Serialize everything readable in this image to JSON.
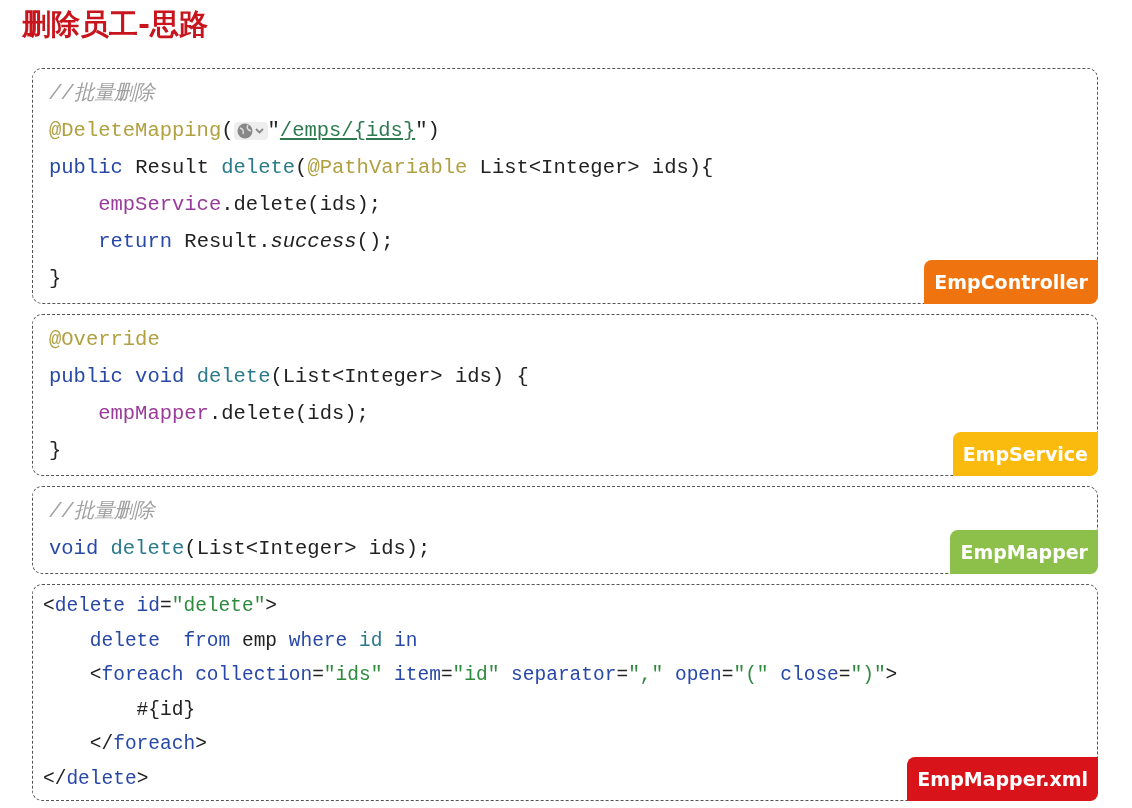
{
  "title": "删除员工-思路",
  "panels": [
    {
      "label": "EmpController",
      "color": "#ef7410",
      "kind": "java",
      "lines": [
        [
          {
            "kind": "comment",
            "text": "//批量删除"
          }
        ],
        [
          {
            "kind": "annotation",
            "text": "@DeleteMapping"
          },
          {
            "kind": "plain",
            "text": "("
          },
          {
            "kind": "icon"
          },
          {
            "kind": "plain",
            "text": "\""
          },
          {
            "kind": "url",
            "text": "/emps/{ids}"
          },
          {
            "kind": "plain",
            "text": "\")"
          }
        ],
        [
          {
            "kind": "keyword",
            "text": "public "
          },
          {
            "kind": "plain",
            "text": "Result "
          },
          {
            "kind": "method",
            "text": "delete"
          },
          {
            "kind": "plain",
            "text": "("
          },
          {
            "kind": "annotation",
            "text": "@PathVariable "
          },
          {
            "kind": "plain",
            "text": "List<Integer> ids){"
          }
        ],
        [
          {
            "kind": "field",
            "text": "    empService"
          },
          {
            "kind": "plain",
            "text": ".delete(ids);"
          }
        ],
        [
          {
            "kind": "keyword",
            "text": "    return "
          },
          {
            "kind": "plain",
            "text": "Result."
          },
          {
            "kind": "italic",
            "text": "success"
          },
          {
            "kind": "plain",
            "text": "();"
          }
        ],
        [
          {
            "kind": "plain",
            "text": "}"
          }
        ]
      ]
    },
    {
      "label": "EmpService",
      "color": "#fbbb0e",
      "kind": "java",
      "lines": [
        [
          {
            "kind": "annotation",
            "text": "@Override"
          }
        ],
        [
          {
            "kind": "keyword",
            "text": "public void "
          },
          {
            "kind": "method",
            "text": "delete"
          },
          {
            "kind": "plain",
            "text": "(List<Integer> ids) {"
          }
        ],
        [
          {
            "kind": "field",
            "text": "    empMapper"
          },
          {
            "kind": "plain",
            "text": ".delete(ids);"
          }
        ],
        [
          {
            "kind": "plain",
            "text": "}"
          }
        ]
      ]
    },
    {
      "label": "EmpMapper",
      "color": "#8cc04b",
      "kind": "java",
      "lines": [
        [
          {
            "kind": "comment",
            "text": "//批量删除"
          }
        ],
        [
          {
            "kind": "keyword",
            "text": "void "
          },
          {
            "kind": "method",
            "text": "delete"
          },
          {
            "kind": "plain",
            "text": "(List<Integer> ids);"
          }
        ]
      ]
    },
    {
      "label": "EmpMapper.xml",
      "color": "#d8141a",
      "kind": "xml",
      "lines": [
        [
          {
            "kind": "plain",
            "text": "<"
          },
          {
            "kind": "keyword",
            "text": "delete id"
          },
          {
            "kind": "plain",
            "text": "="
          },
          {
            "kind": "string",
            "text": "\"delete\""
          },
          {
            "kind": "plain",
            "text": ">"
          }
        ],
        [
          {
            "kind": "keyword",
            "text": "    delete  from "
          },
          {
            "kind": "plain",
            "text": "emp "
          },
          {
            "kind": "keyword",
            "text": "where "
          },
          {
            "kind": "method",
            "text": "id "
          },
          {
            "kind": "keyword",
            "text": "in"
          }
        ],
        [
          {
            "kind": "plain",
            "text": "    <"
          },
          {
            "kind": "keyword",
            "text": "foreach collection"
          },
          {
            "kind": "plain",
            "text": "="
          },
          {
            "kind": "string",
            "text": "\"ids\" "
          },
          {
            "kind": "keyword",
            "text": "item"
          },
          {
            "kind": "plain",
            "text": "="
          },
          {
            "kind": "string",
            "text": "\"id\" "
          },
          {
            "kind": "keyword",
            "text": "separator"
          },
          {
            "kind": "plain",
            "text": "="
          },
          {
            "kind": "string",
            "text": "\",\" "
          },
          {
            "kind": "keyword",
            "text": "open"
          },
          {
            "kind": "plain",
            "text": "="
          },
          {
            "kind": "string",
            "text": "\"(\" "
          },
          {
            "kind": "keyword",
            "text": "close"
          },
          {
            "kind": "plain",
            "text": "="
          },
          {
            "kind": "string",
            "text": "\")\""
          },
          {
            "kind": "plain",
            "text": ">"
          }
        ],
        [
          {
            "kind": "plain",
            "text": "        #{id}"
          }
        ],
        [
          {
            "kind": "plain",
            "text": "    </"
          },
          {
            "kind": "keyword",
            "text": "foreach"
          },
          {
            "kind": "plain",
            "text": ">"
          }
        ],
        [
          {
            "kind": "plain",
            "text": "</"
          },
          {
            "kind": "keyword",
            "text": "delete"
          },
          {
            "kind": "plain",
            "text": ">"
          }
        ]
      ]
    }
  ]
}
